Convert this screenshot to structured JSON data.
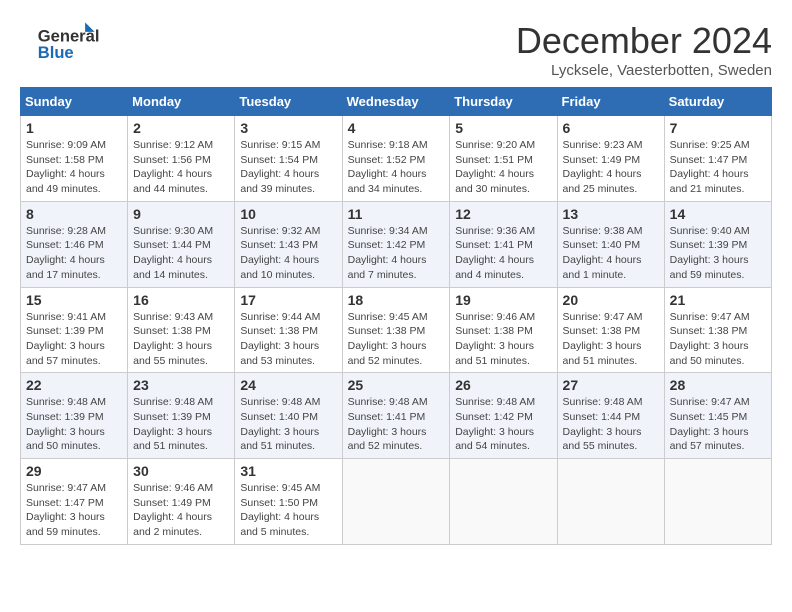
{
  "header": {
    "logo_general": "General",
    "logo_blue": "Blue",
    "month_title": "December 2024",
    "subtitle": "Lycksele, Vaesterbotten, Sweden"
  },
  "columns": [
    "Sunday",
    "Monday",
    "Tuesday",
    "Wednesday",
    "Thursday",
    "Friday",
    "Saturday"
  ],
  "weeks": [
    [
      {
        "day": "1",
        "sunrise": "Sunrise: 9:09 AM",
        "sunset": "Sunset: 1:58 PM",
        "daylight": "Daylight: 4 hours and 49 minutes."
      },
      {
        "day": "2",
        "sunrise": "Sunrise: 9:12 AM",
        "sunset": "Sunset: 1:56 PM",
        "daylight": "Daylight: 4 hours and 44 minutes."
      },
      {
        "day": "3",
        "sunrise": "Sunrise: 9:15 AM",
        "sunset": "Sunset: 1:54 PM",
        "daylight": "Daylight: 4 hours and 39 minutes."
      },
      {
        "day": "4",
        "sunrise": "Sunrise: 9:18 AM",
        "sunset": "Sunset: 1:52 PM",
        "daylight": "Daylight: 4 hours and 34 minutes."
      },
      {
        "day": "5",
        "sunrise": "Sunrise: 9:20 AM",
        "sunset": "Sunset: 1:51 PM",
        "daylight": "Daylight: 4 hours and 30 minutes."
      },
      {
        "day": "6",
        "sunrise": "Sunrise: 9:23 AM",
        "sunset": "Sunset: 1:49 PM",
        "daylight": "Daylight: 4 hours and 25 minutes."
      },
      {
        "day": "7",
        "sunrise": "Sunrise: 9:25 AM",
        "sunset": "Sunset: 1:47 PM",
        "daylight": "Daylight: 4 hours and 21 minutes."
      }
    ],
    [
      {
        "day": "8",
        "sunrise": "Sunrise: 9:28 AM",
        "sunset": "Sunset: 1:46 PM",
        "daylight": "Daylight: 4 hours and 17 minutes."
      },
      {
        "day": "9",
        "sunrise": "Sunrise: 9:30 AM",
        "sunset": "Sunset: 1:44 PM",
        "daylight": "Daylight: 4 hours and 14 minutes."
      },
      {
        "day": "10",
        "sunrise": "Sunrise: 9:32 AM",
        "sunset": "Sunset: 1:43 PM",
        "daylight": "Daylight: 4 hours and 10 minutes."
      },
      {
        "day": "11",
        "sunrise": "Sunrise: 9:34 AM",
        "sunset": "Sunset: 1:42 PM",
        "daylight": "Daylight: 4 hours and 7 minutes."
      },
      {
        "day": "12",
        "sunrise": "Sunrise: 9:36 AM",
        "sunset": "Sunset: 1:41 PM",
        "daylight": "Daylight: 4 hours and 4 minutes."
      },
      {
        "day": "13",
        "sunrise": "Sunrise: 9:38 AM",
        "sunset": "Sunset: 1:40 PM",
        "daylight": "Daylight: 4 hours and 1 minute."
      },
      {
        "day": "14",
        "sunrise": "Sunrise: 9:40 AM",
        "sunset": "Sunset: 1:39 PM",
        "daylight": "Daylight: 3 hours and 59 minutes."
      }
    ],
    [
      {
        "day": "15",
        "sunrise": "Sunrise: 9:41 AM",
        "sunset": "Sunset: 1:39 PM",
        "daylight": "Daylight: 3 hours and 57 minutes."
      },
      {
        "day": "16",
        "sunrise": "Sunrise: 9:43 AM",
        "sunset": "Sunset: 1:38 PM",
        "daylight": "Daylight: 3 hours and 55 minutes."
      },
      {
        "day": "17",
        "sunrise": "Sunrise: 9:44 AM",
        "sunset": "Sunset: 1:38 PM",
        "daylight": "Daylight: 3 hours and 53 minutes."
      },
      {
        "day": "18",
        "sunrise": "Sunrise: 9:45 AM",
        "sunset": "Sunset: 1:38 PM",
        "daylight": "Daylight: 3 hours and 52 minutes."
      },
      {
        "day": "19",
        "sunrise": "Sunrise: 9:46 AM",
        "sunset": "Sunset: 1:38 PM",
        "daylight": "Daylight: 3 hours and 51 minutes."
      },
      {
        "day": "20",
        "sunrise": "Sunrise: 9:47 AM",
        "sunset": "Sunset: 1:38 PM",
        "daylight": "Daylight: 3 hours and 51 minutes."
      },
      {
        "day": "21",
        "sunrise": "Sunrise: 9:47 AM",
        "sunset": "Sunset: 1:38 PM",
        "daylight": "Daylight: 3 hours and 50 minutes."
      }
    ],
    [
      {
        "day": "22",
        "sunrise": "Sunrise: 9:48 AM",
        "sunset": "Sunset: 1:39 PM",
        "daylight": "Daylight: 3 hours and 50 minutes."
      },
      {
        "day": "23",
        "sunrise": "Sunrise: 9:48 AM",
        "sunset": "Sunset: 1:39 PM",
        "daylight": "Daylight: 3 hours and 51 minutes."
      },
      {
        "day": "24",
        "sunrise": "Sunrise: 9:48 AM",
        "sunset": "Sunset: 1:40 PM",
        "daylight": "Daylight: 3 hours and 51 minutes."
      },
      {
        "day": "25",
        "sunrise": "Sunrise: 9:48 AM",
        "sunset": "Sunset: 1:41 PM",
        "daylight": "Daylight: 3 hours and 52 minutes."
      },
      {
        "day": "26",
        "sunrise": "Sunrise: 9:48 AM",
        "sunset": "Sunset: 1:42 PM",
        "daylight": "Daylight: 3 hours and 54 minutes."
      },
      {
        "day": "27",
        "sunrise": "Sunrise: 9:48 AM",
        "sunset": "Sunset: 1:44 PM",
        "daylight": "Daylight: 3 hours and 55 minutes."
      },
      {
        "day": "28",
        "sunrise": "Sunrise: 9:47 AM",
        "sunset": "Sunset: 1:45 PM",
        "daylight": "Daylight: 3 hours and 57 minutes."
      }
    ],
    [
      {
        "day": "29",
        "sunrise": "Sunrise: 9:47 AM",
        "sunset": "Sunset: 1:47 PM",
        "daylight": "Daylight: 3 hours and 59 minutes."
      },
      {
        "day": "30",
        "sunrise": "Sunrise: 9:46 AM",
        "sunset": "Sunset: 1:49 PM",
        "daylight": "Daylight: 4 hours and 2 minutes."
      },
      {
        "day": "31",
        "sunrise": "Sunrise: 9:45 AM",
        "sunset": "Sunset: 1:50 PM",
        "daylight": "Daylight: 4 hours and 5 minutes."
      },
      null,
      null,
      null,
      null
    ]
  ]
}
